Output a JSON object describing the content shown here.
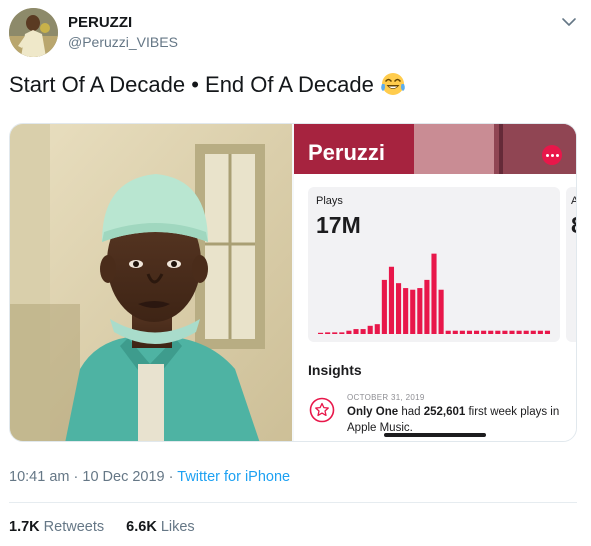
{
  "tweet": {
    "author_name": "PERUZZI",
    "author_handle": "@Peruzzi_VIBES",
    "text": "Start Of A Decade • End Of A Decade",
    "emoji": "face-with-tears-of-joy",
    "time": "10:41 am",
    "separator": "·",
    "date": "10 Dec 2019",
    "source": "Twitter for iPhone",
    "retweets_count": "1.7K",
    "retweets_label": "Retweets",
    "likes_count": "6.6K",
    "likes_label": "Likes"
  },
  "media": {
    "photo_left": "selfie-in-surgical-scrubs",
    "apple_music": {
      "artist": "Peruzzi",
      "plays_label": "Plays",
      "plays_value": "17M",
      "side_card_partial_label": "A",
      "side_card_partial_value": "8",
      "insights_title": "Insights",
      "insight_date": "OCTOBER 31, 2019",
      "insight_song": "Only One",
      "insight_text_1": " had ",
      "insight_number": "252,601",
      "insight_text_2": " first week plays in Apple Music.",
      "accent_color": "#e8174a"
    }
  },
  "chart_data": {
    "type": "bar",
    "title": "",
    "xlabel": "",
    "ylabel": "",
    "values": [
      0,
      1,
      1,
      1,
      2,
      3,
      3,
      5,
      6,
      33,
      41,
      31,
      28,
      27,
      28,
      33,
      49,
      27,
      2,
      2,
      2,
      2,
      2,
      2,
      2,
      2,
      2,
      2,
      2,
      2,
      2,
      2,
      2
    ],
    "ylim": [
      0,
      50
    ],
    "color": "#e8174a",
    "grid": false
  },
  "colors": {
    "link": "#1da1f2",
    "text_primary": "#14171a",
    "text_secondary": "#657786",
    "apple_music_accent": "#e8174a"
  },
  "icons": {
    "menu": "chevron-down-icon",
    "insight": "star-badge-icon",
    "more": "more-dots-icon"
  }
}
